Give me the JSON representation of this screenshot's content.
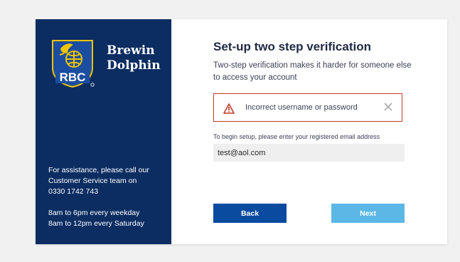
{
  "brand": {
    "logo_text": "RBC",
    "name_line1": "Brewin",
    "name_line2": "Dolphin"
  },
  "sidebar": {
    "assist_line1": "For assistance, please call our",
    "assist_line2": "Customer Service team on",
    "phone": "0330 1742 743",
    "hours_line1": "8am to 6pm every weekday",
    "hours_line2": "8am to 12pm every Saturday"
  },
  "main": {
    "title": "Set-up two step verification",
    "subtitle": "Two-step verification makes it harder for someone else to access your account",
    "alert": {
      "message": "Incorrect username or password",
      "icon": "warning-triangle-icon",
      "close_icon": "close-icon"
    },
    "email_label": "To begin setup, please enter your registered email address",
    "email_value": "test@aol.com",
    "back_label": "Back",
    "next_label": "Next"
  },
  "colors": {
    "sidebar_bg": "#0c2d62",
    "back_button": "#0a4a9f",
    "next_button": "#5bb7e6",
    "alert_border": "#c0392b"
  }
}
